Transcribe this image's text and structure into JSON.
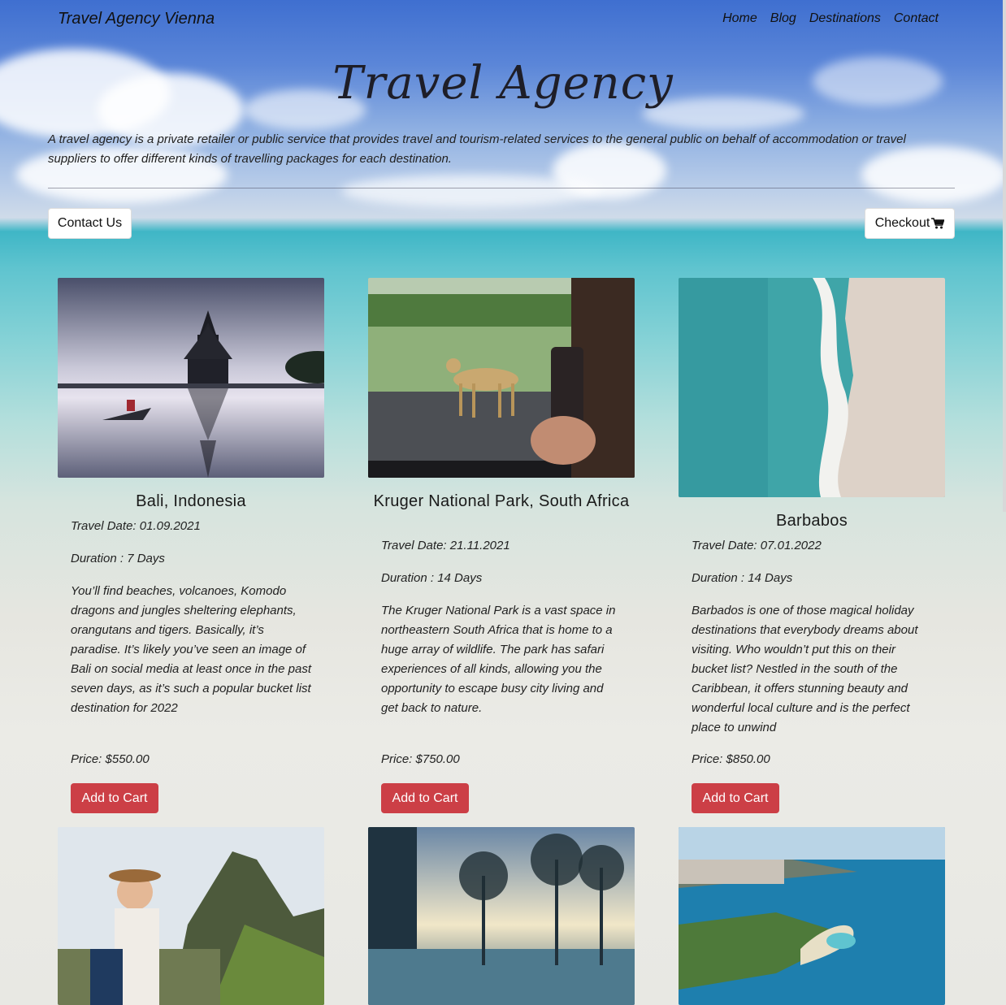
{
  "nav": {
    "brand": "Travel Agency Vienna",
    "links": [
      "Home",
      "Blog",
      "Destinations",
      "Contact"
    ]
  },
  "hero": {
    "title": "Travel Agency",
    "text": "A travel agency is a private retailer or public service that provides travel and tourism-related services to the general public on behalf of accommodation or travel suppliers to offer different kinds of travelling packages for each destination.",
    "contact_label": "Contact Us",
    "checkout_label": "Checkout",
    "checkout_icon": "shopping-cart-icon"
  },
  "cards": [
    {
      "title": "Bali, Indonesia",
      "date": "Travel Date: 01.09.2021",
      "duration": "Duration : 7 Days",
      "description": "You’ll find beaches, volcanoes, Komodo dragons and jungles sheltering elephants, orangutans and tigers. Basically, it’s paradise. It’s likely you’ve seen an image of Bali on social media at least once in the past seven days, as it’s such a popular bucket list destination for 2022",
      "price": "Price: $550.00",
      "button": "Add to Cart",
      "image": "bali-temple-photo"
    },
    {
      "title": "Kruger National Park, South Africa",
      "date": "Travel Date: 21.11.2021",
      "duration": "Duration : 14 Days",
      "description": "The Kruger National Park is a vast space in northeastern South Africa that is home to a huge array of wildlife. The park has safari experiences of all kinds, allowing you the opportunity to escape busy city living and get back to nature.",
      "price": "Price: $750.00",
      "button": "Add to Cart",
      "image": "cheetah-safari-photo"
    },
    {
      "title": "Barbabos",
      "date": "Travel Date: 07.01.2022",
      "duration": "Duration : 14 Days",
      "description": "Barbados is one of those magical holiday destinations that everybody dreams about visiting. Who wouldn’t put this on their bucket list? Nestled in the south of the Caribbean, it offers stunning beauty and wonderful local culture and is the perfect place to unwind",
      "price": "Price: $850.00",
      "button": "Add to Cart",
      "image": "aerial-beach-photo"
    }
  ],
  "row2_images": [
    "machu-picchu-photo",
    "palm-pool-sunset-photo",
    "honolulu-coast-photo"
  ],
  "colors": {
    "accent_button": "#cc3f46",
    "sky": "#3f6fd0",
    "sea": "#3fb6c6"
  }
}
